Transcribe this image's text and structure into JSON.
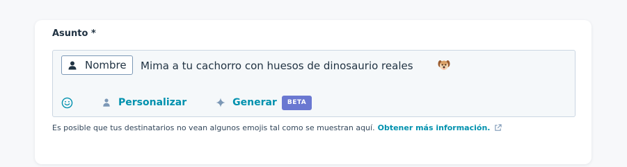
{
  "field": {
    "label": "Asunto *"
  },
  "subject": {
    "token_label": "Nombre",
    "text": "Mima a tu cachorro con huesos de dinosaurio reales",
    "emoji": "dog-face-emoji"
  },
  "toolbar": {
    "emoji_icon": "smiley-icon",
    "personalize_label": "Personalizar",
    "generate_label": "Generar",
    "beta_badge": "BETA"
  },
  "help": {
    "text": "Es posible que tus destinatarios no vean algunos emojis tal como se muestran aquí.",
    "link_label": "Obtener más información.",
    "link_icon": "external-link-icon"
  },
  "colors": {
    "accent": "#0091ae",
    "beta": "#6a78d1",
    "text": "#213343",
    "editor_bg": "#f5f8fa",
    "border": "#cbd6e2"
  }
}
